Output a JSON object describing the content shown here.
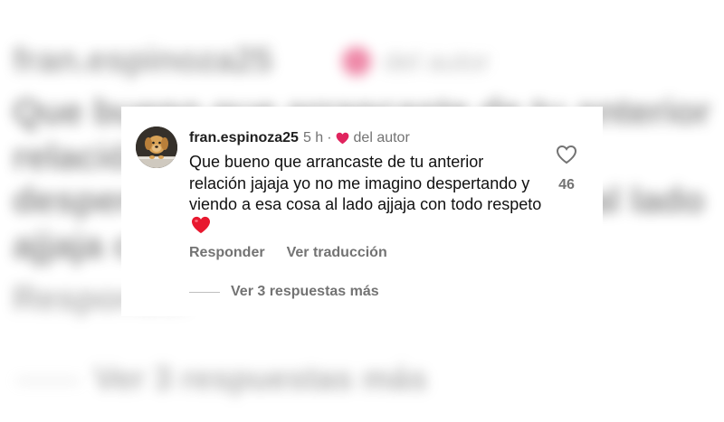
{
  "comment": {
    "username": "fran.espinoza25",
    "time": "5 h",
    "separator": "·",
    "liked_by_author_label": "del autor",
    "text": "Que bueno que arrancaste de tu anterior relación jajaja yo no me imagino despertando y viendo a esa cosa al lado ajjaja con todo respeto",
    "emoji": "red-heart",
    "like_count": "46",
    "actions": {
      "reply_label": "Responder",
      "translate_label": "Ver traducción"
    },
    "replies_label": "Ver 3 respuestas más"
  },
  "background_blurred": {
    "username": "fran.espinoza25",
    "time": "5 h ·",
    "liked_by_author_label": "del autor",
    "text_lines": [
      "Que bueno que arrancaste de tu anterior",
      "relación jajaja yo no me imagino",
      "despertando y viendo a esa cosa al lado",
      "ajjaja con todo respeto"
    ],
    "reply_label": "Responder",
    "replies_label": "Ver 3 respuestas más"
  },
  "icons": {
    "avatar": "dog-photo",
    "author_like": "heart-icon",
    "like_button": "heart-outline-icon"
  },
  "colors": {
    "heart_red": "#e0245e",
    "muted_text": "#737373",
    "primary_text": "#111111"
  }
}
